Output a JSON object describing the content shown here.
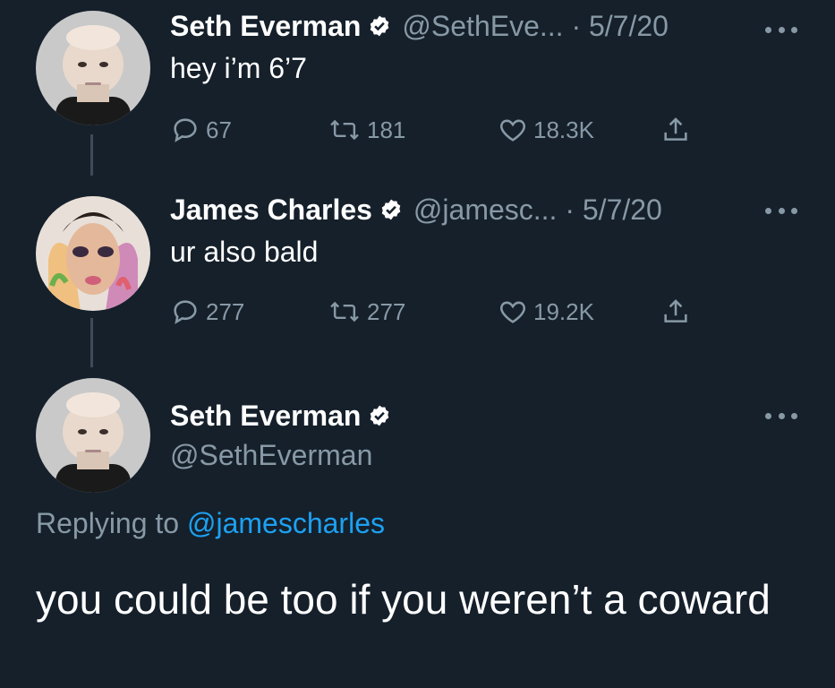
{
  "theme": {
    "background": "#15202b",
    "text": "#ffffff",
    "secondary_text": "#8899a6",
    "accent": "#1da1f2",
    "thread_line": "#3d4a57"
  },
  "tweets": [
    {
      "display_name": "Seth Everman",
      "verified": true,
      "handle_meta": "@SethEve... · 5/7/20",
      "text": "hey i’m 6’7",
      "replies": "67",
      "retweets": "181",
      "likes": "18.3K",
      "avatar_icon": "bald-man-avatar"
    },
    {
      "display_name": "James Charles",
      "verified": true,
      "handle_meta": "@jamesc... · 5/7/20",
      "text": "ur also bald",
      "replies": "277",
      "retweets": "277",
      "likes": "19.2K",
      "avatar_icon": "makeup-artist-avatar"
    }
  ],
  "main_tweet": {
    "display_name": "Seth Everman",
    "verified": true,
    "handle": "@SethEverman",
    "replying_prefix": "Replying to",
    "replying_to": "@jamescharles",
    "text": "you could be too if you weren’t a coward",
    "avatar_icon": "bald-man-avatar"
  }
}
